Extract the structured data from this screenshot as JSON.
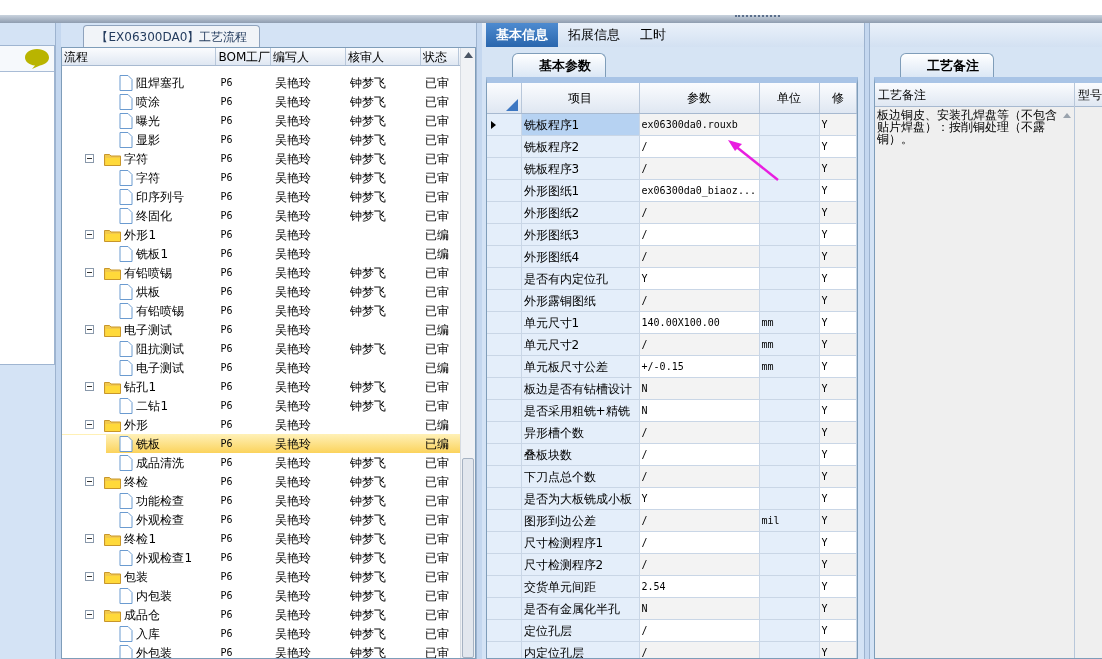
{
  "process_panel": {
    "title": "【EX06300DA0】工艺流程",
    "columns": [
      "流程",
      "BOM工厂",
      "编写人",
      "核审人",
      "状态"
    ],
    "rows": [
      {
        "kind": "file",
        "label": "阻焊塞孔",
        "bom": "P6",
        "writer": "吴艳玲",
        "reviewer": "钟梦飞",
        "status": "已审",
        "selected": false
      },
      {
        "kind": "file",
        "label": "喷涂",
        "bom": "P6",
        "writer": "吴艳玲",
        "reviewer": "钟梦飞",
        "status": "已审",
        "selected": false
      },
      {
        "kind": "file",
        "label": "曝光",
        "bom": "P6",
        "writer": "吴艳玲",
        "reviewer": "钟梦飞",
        "status": "已审",
        "selected": false
      },
      {
        "kind": "file",
        "label": "显影",
        "bom": "P6",
        "writer": "吴艳玲",
        "reviewer": "钟梦飞",
        "status": "已审",
        "selected": false
      },
      {
        "kind": "folder",
        "label": "字符",
        "bom": "P6",
        "writer": "吴艳玲",
        "reviewer": "钟梦飞",
        "status": "已审",
        "selected": false,
        "expanded": true,
        "children": [
          {
            "kind": "file",
            "label": "字符",
            "bom": "P6",
            "writer": "吴艳玲",
            "reviewer": "钟梦飞",
            "status": "已审",
            "selected": false
          },
          {
            "kind": "file",
            "label": "印序列号",
            "bom": "P6",
            "writer": "吴艳玲",
            "reviewer": "钟梦飞",
            "status": "已审",
            "selected": false
          },
          {
            "kind": "file",
            "label": "终固化",
            "bom": "P6",
            "writer": "吴艳玲",
            "reviewer": "钟梦飞",
            "status": "已审",
            "selected": false
          }
        ]
      },
      {
        "kind": "folder",
        "label": "外形1",
        "bom": "P6",
        "writer": "吴艳玲",
        "status": "已编",
        "selected": false,
        "expanded": true,
        "children": [
          {
            "kind": "file",
            "label": "铣板1",
            "bom": "P6",
            "writer": "吴艳玲",
            "status": "已编",
            "selected": false
          }
        ]
      },
      {
        "kind": "folder",
        "label": "有铅喷锡",
        "bom": "P6",
        "writer": "吴艳玲",
        "reviewer": "钟梦飞",
        "status": "已审",
        "selected": false,
        "expanded": true,
        "children": [
          {
            "kind": "file",
            "label": "烘板",
            "bom": "P6",
            "writer": "吴艳玲",
            "reviewer": "钟梦飞",
            "status": "已审",
            "selected": false
          },
          {
            "kind": "file",
            "label": "有铅喷锡",
            "bom": "P6",
            "writer": "吴艳玲",
            "reviewer": "钟梦飞",
            "status": "已审",
            "selected": false
          }
        ]
      },
      {
        "kind": "folder",
        "label": "电子测试",
        "bom": "P6",
        "writer": "吴艳玲",
        "status": "已编",
        "selected": false,
        "expanded": true,
        "children": [
          {
            "kind": "file",
            "label": "阻抗测试",
            "bom": "P6",
            "writer": "吴艳玲",
            "reviewer": "钟梦飞",
            "status": "已审",
            "selected": false
          },
          {
            "kind": "file",
            "label": "电子测试",
            "bom": "P6",
            "writer": "吴艳玲",
            "status": "已编",
            "selected": false
          }
        ]
      },
      {
        "kind": "folder",
        "label": "钻孔1",
        "bom": "P6",
        "writer": "吴艳玲",
        "reviewer": "钟梦飞",
        "status": "已审",
        "selected": false,
        "expanded": true,
        "children": [
          {
            "kind": "file",
            "label": "二钻1",
            "bom": "P6",
            "writer": "吴艳玲",
            "reviewer": "钟梦飞",
            "status": "已审",
            "selected": false
          }
        ]
      },
      {
        "kind": "folder",
        "label": "外形",
        "bom": "P6",
        "writer": "吴艳玲",
        "status": "已编",
        "selected": false,
        "expanded": true,
        "children": [
          {
            "kind": "file",
            "label": "铣板",
            "bom": "P6",
            "writer": "吴艳玲",
            "status": "已编",
            "selected": true
          },
          {
            "kind": "file",
            "label": "成品清洗",
            "bom": "P6",
            "writer": "吴艳玲",
            "reviewer": "钟梦飞",
            "status": "已审",
            "selected": false
          }
        ]
      },
      {
        "kind": "folder",
        "label": "终检",
        "bom": "P6",
        "writer": "吴艳玲",
        "reviewer": "钟梦飞",
        "status": "已审",
        "selected": false,
        "expanded": true,
        "children": [
          {
            "kind": "file",
            "label": "功能检查",
            "bom": "P6",
            "writer": "吴艳玲",
            "reviewer": "钟梦飞",
            "status": "已审",
            "selected": false
          },
          {
            "kind": "file",
            "label": "外观检查",
            "bom": "P6",
            "writer": "吴艳玲",
            "reviewer": "钟梦飞",
            "status": "已审",
            "selected": false
          }
        ]
      },
      {
        "kind": "folder",
        "label": "终检1",
        "bom": "P6",
        "writer": "吴艳玲",
        "reviewer": "钟梦飞",
        "status": "已审",
        "selected": false,
        "expanded": true,
        "children": [
          {
            "kind": "file",
            "label": "外观检查1",
            "bom": "P6",
            "writer": "吴艳玲",
            "reviewer": "钟梦飞",
            "status": "已审",
            "selected": false
          }
        ]
      },
      {
        "kind": "folder",
        "label": "包装",
        "bom": "P6",
        "writer": "吴艳玲",
        "reviewer": "钟梦飞",
        "status": "已审",
        "selected": false,
        "expanded": true,
        "children": [
          {
            "kind": "file",
            "label": "内包装",
            "bom": "P6",
            "writer": "吴艳玲",
            "reviewer": "钟梦飞",
            "status": "已审",
            "selected": false
          }
        ]
      },
      {
        "kind": "folder",
        "label": "成品仓",
        "bom": "P6",
        "writer": "吴艳玲",
        "reviewer": "钟梦飞",
        "status": "已审",
        "selected": false,
        "expanded": true,
        "children": [
          {
            "kind": "file",
            "label": "入库",
            "bom": "P6",
            "writer": "吴艳玲",
            "reviewer": "钟梦飞",
            "status": "已审",
            "selected": false
          },
          {
            "kind": "file",
            "label": "外包装",
            "bom": "P6",
            "writer": "吴艳玲",
            "reviewer": "钟梦飞",
            "status": "已审",
            "selected": false
          }
        ]
      }
    ]
  },
  "detail_tabs": [
    {
      "label": "基本信息",
      "selected": true
    },
    {
      "label": "拓展信息",
      "selected": false
    },
    {
      "label": "工时",
      "selected": false
    }
  ],
  "param_tab": {
    "label": "基本参数"
  },
  "param_table": {
    "columns": [
      "项目",
      "参数",
      "单位",
      "修"
    ],
    "rows": [
      {
        "item": "铣板程序1",
        "value": "ex06300da0.rouxb",
        "modify": "Y",
        "current": true
      },
      {
        "item": "铣板程序2",
        "value": "/",
        "modify": "Y",
        "current": false
      },
      {
        "item": "铣板程序3",
        "value": "/",
        "modify": "Y",
        "current": false
      },
      {
        "item": "外形图纸1",
        "value": "ex06300da0_biaoz...",
        "modify": "Y",
        "current": false
      },
      {
        "item": "外形图纸2",
        "value": "/",
        "modify": "Y",
        "current": false
      },
      {
        "item": "外形图纸3",
        "value": "/",
        "modify": "Y",
        "current": false
      },
      {
        "item": "外形图纸4",
        "value": "/",
        "modify": "Y",
        "current": false
      },
      {
        "item": "是否有内定位孔",
        "value": "Y",
        "modify": "Y",
        "current": false
      },
      {
        "item": "外形露铜图纸",
        "value": "/",
        "modify": "Y",
        "current": false
      },
      {
        "item": "单元尺寸1",
        "value": "140.00X100.00",
        "unit": "mm",
        "modify": "Y",
        "current": false
      },
      {
        "item": "单元尺寸2",
        "value": "/",
        "unit": "mm",
        "modify": "Y",
        "current": false
      },
      {
        "item": "单元板尺寸公差",
        "value": "+/-0.15",
        "unit": "mm",
        "modify": "Y",
        "current": false
      },
      {
        "item": "板边是否有钻槽设计",
        "value": "N",
        "modify": "Y",
        "current": false
      },
      {
        "item": "是否采用粗铣+精铣",
        "value": "N",
        "modify": "Y",
        "current": false
      },
      {
        "item": "异形槽个数",
        "value": "/",
        "modify": "Y",
        "current": false
      },
      {
        "item": "叠板块数",
        "value": "/",
        "modify": "Y",
        "current": false
      },
      {
        "item": "下刀点总个数",
        "value": "/",
        "modify": "Y",
        "current": false
      },
      {
        "item": "是否为大板铣成小板",
        "value": "Y",
        "modify": "Y",
        "current": false
      },
      {
        "item": "图形到边公差",
        "value": "/",
        "unit": "mil",
        "modify": "Y",
        "current": false
      },
      {
        "item": "尺寸检测程序1",
        "value": "/",
        "modify": "Y",
        "current": false
      },
      {
        "item": "尺寸检测程序2",
        "value": "/",
        "modify": "Y",
        "current": false
      },
      {
        "item": "交货单元间距",
        "value": "2.54",
        "modify": "Y",
        "current": false
      },
      {
        "item": "是否有金属化半孔",
        "value": "N",
        "modify": "Y",
        "current": false
      },
      {
        "item": "定位孔层",
        "value": "/",
        "modify": "Y",
        "current": false
      },
      {
        "item": "内定位孔层",
        "value": "/",
        "modify": "Y",
        "current": false
      }
    ]
  },
  "note_tab": {
    "label": "工艺备注"
  },
  "note_table": {
    "columns": [
      "工艺备注",
      "型号"
    ],
    "text": "板边铜皮、安装孔焊盘等（不包含贴片焊盘）：按削铜处理（不露铜）。"
  }
}
